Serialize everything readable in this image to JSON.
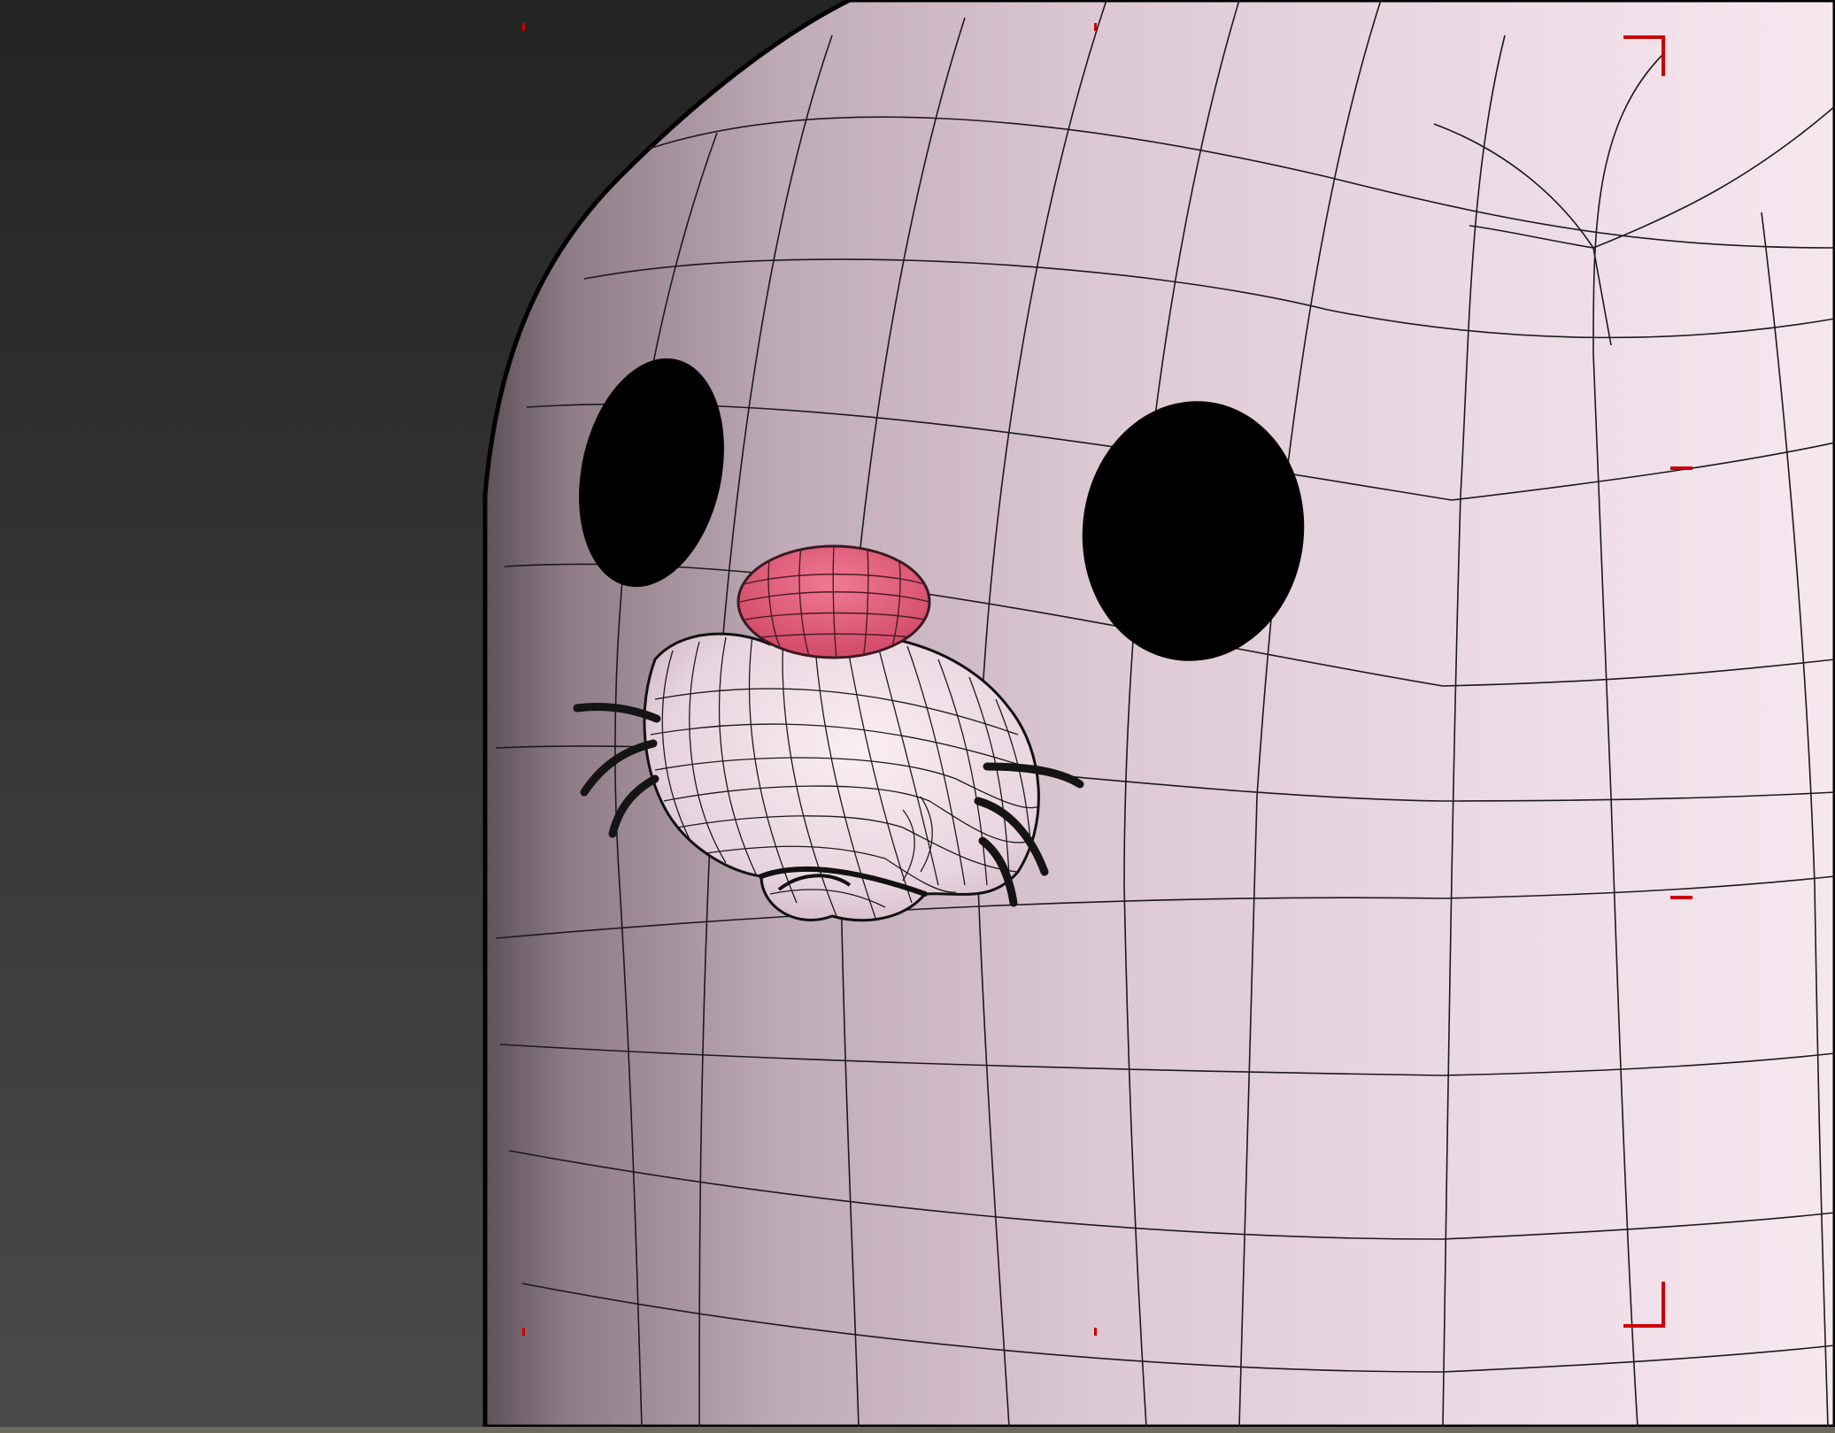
{
  "viewport": {
    "view": "perspective",
    "shading": "shaded-with-wireframe",
    "background_top": "#232323",
    "background_bottom": "#4a4a4a",
    "safe_frame_color": "#cc0000"
  },
  "model": {
    "body_color": "#f4e2ec",
    "body_shadow_color": "#8d7b86",
    "eye_color": "#000000",
    "nose_color": "#e8607c",
    "wireframe_color": "#1a1a1a"
  }
}
